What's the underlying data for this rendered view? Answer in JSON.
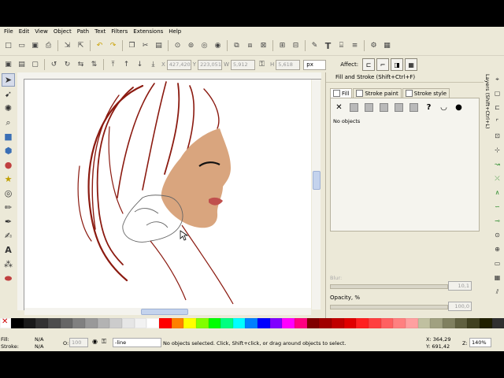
{
  "menu": [
    "File",
    "Edit",
    "View",
    "Object",
    "Path",
    "Text",
    "Filters",
    "Extensions",
    "Help"
  ],
  "toolbar": {
    "x_label": "X",
    "x_value": "427,420",
    "y_label": "Y",
    "y_value": "223,051",
    "w_label": "W",
    "w_value": "5,912",
    "h_label": "H",
    "h_value": "5,618",
    "unit": "px",
    "affect_label": "Affect:"
  },
  "panel": {
    "title": "Fill and Stroke (Shift+Ctrl+F)",
    "tabs": [
      "Fill",
      "Stroke paint",
      "Stroke style"
    ],
    "no_objects": "No objects",
    "blur_label": "Blur:",
    "blur_value": "10,1",
    "opacity_label": "Opacity, %",
    "opacity_value": "100,0"
  },
  "layers_tab": "Layers (Shift+Ctrl+L)",
  "status": {
    "fill_label": "Fill:",
    "stroke_label": "Stroke:",
    "fill_value": "N/A",
    "stroke_value": "N/A",
    "o_label": "O:",
    "o_value": "100",
    "layer": "-line",
    "message": "No objects selected. Click, Shift+click, or drag around objects to select.",
    "x_coord": "X: 364,29",
    "y_coord": "Y: 691,42",
    "zoom_label": "Z:",
    "zoom_value": "140%"
  },
  "palette": [
    "#000000",
    "#1a1a1a",
    "#333333",
    "#4d4d4d",
    "#666666",
    "#808080",
    "#999999",
    "#b3b3b3",
    "#cccccc",
    "#e6e6e6",
    "#f2f2f2",
    "#ffffff",
    "#ff0000",
    "#ff8000",
    "#ffff00",
    "#80ff00",
    "#00ff00",
    "#00ff80",
    "#00ffff",
    "#0080ff",
    "#0000ff",
    "#8000ff",
    "#ff00ff",
    "#ff0080",
    "#800000",
    "#a00000",
    "#c00000",
    "#e00000",
    "#ff2020",
    "#ff4040",
    "#ff6060",
    "#ff8080",
    "#ffa0a0",
    "#c0c0a0",
    "#a0a080",
    "#808060",
    "#606040",
    "#404020",
    "#202000",
    "#303030"
  ],
  "colors": {
    "hair": "#8b1a10",
    "skin": "#d9a57e",
    "lips": "#c0504d"
  }
}
